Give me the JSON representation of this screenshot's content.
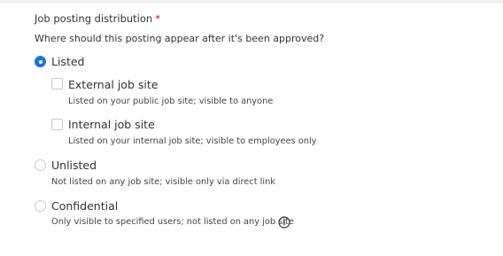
{
  "field": {
    "label": "Job posting distribution",
    "required_marker": "*",
    "question": "Where should this posting appear after it's been approved?"
  },
  "options": {
    "listed": {
      "label": "Listed",
      "selected": true,
      "suboptions": {
        "external": {
          "label": "External job site",
          "description": "Listed on your public job site; visible to anyone",
          "checked": false
        },
        "internal": {
          "label": "Internal job site",
          "description": "Listed on your internal job site; visible to employees only",
          "checked": false
        }
      }
    },
    "unlisted": {
      "label": "Unlisted",
      "description": "Not listed on any job site; visible only via direct link",
      "selected": false
    },
    "confidential": {
      "label": "Confidential",
      "description": "Only visible to specified users; not listed on any job site",
      "selected": false
    }
  },
  "icons": {
    "info": "info-circle-icon"
  },
  "colors": {
    "accent": "#1a73e8",
    "required": "#c8102e",
    "control_border": "#c7c9cc"
  }
}
